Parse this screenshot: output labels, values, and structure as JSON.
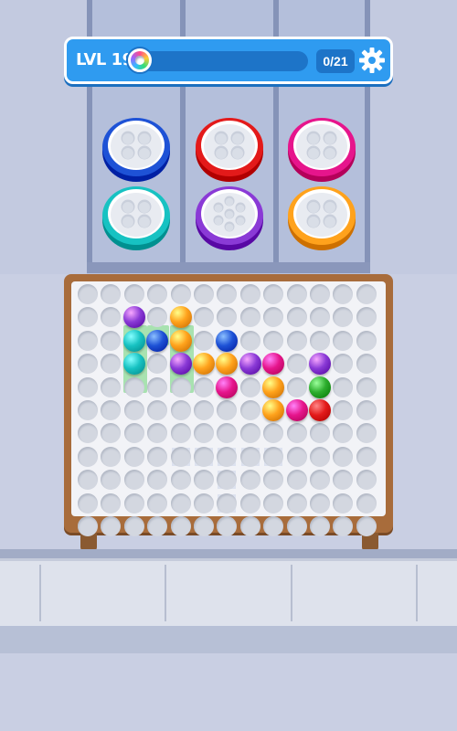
{
  "hud": {
    "level": "LVL 19",
    "progress": "0/21",
    "progress_fraction": 0.0
  },
  "colors": {
    "purple": "#8a3ad6",
    "blue": "#1e52d6",
    "orange": "#ffa21c",
    "cyan": "#17c2c2",
    "pink": "#e6158c",
    "green": "#2dad2d",
    "red": "#e31a1a",
    "board_wood": "#a86c3b",
    "hud_blue": "#2f9bf0"
  },
  "containers": [
    {
      "color": "cyan",
      "state": "in-dispenser"
    },
    {
      "color": "purple",
      "state": "in-dispenser"
    },
    {
      "color": "orange",
      "state": "in-dispenser"
    },
    {
      "color": "blue",
      "state": "in-dispenser"
    },
    {
      "color": "red",
      "state": "in-dispenser"
    },
    {
      "color": "pink",
      "state": "in-dispenser"
    }
  ],
  "balls": [
    {
      "r": 1,
      "c": 2,
      "color": "purple"
    },
    {
      "r": 1,
      "c": 4,
      "color": "orange"
    },
    {
      "r": 2,
      "c": 2,
      "color": "cyan"
    },
    {
      "r": 2,
      "c": 3,
      "color": "blue"
    },
    {
      "r": 2,
      "c": 4,
      "color": "orange"
    },
    {
      "r": 2,
      "c": 6,
      "color": "blue"
    },
    {
      "r": 3,
      "c": 2,
      "color": "cyan"
    },
    {
      "r": 3,
      "c": 4,
      "color": "purple"
    },
    {
      "r": 3,
      "c": 5,
      "color": "orange"
    },
    {
      "r": 3,
      "c": 6,
      "color": "orange"
    },
    {
      "r": 3,
      "c": 7,
      "color": "purple"
    },
    {
      "r": 3,
      "c": 8,
      "color": "pink"
    },
    {
      "r": 3,
      "c": 10,
      "color": "purple"
    },
    {
      "r": 4,
      "c": 6,
      "color": "pink"
    },
    {
      "r": 4,
      "c": 8,
      "color": "orange"
    },
    {
      "r": 4,
      "c": 10,
      "color": "green"
    },
    {
      "r": 5,
      "c": 8,
      "color": "orange"
    },
    {
      "r": 5,
      "c": 9,
      "color": "pink"
    },
    {
      "r": 5,
      "c": 10,
      "color": "red"
    }
  ]
}
